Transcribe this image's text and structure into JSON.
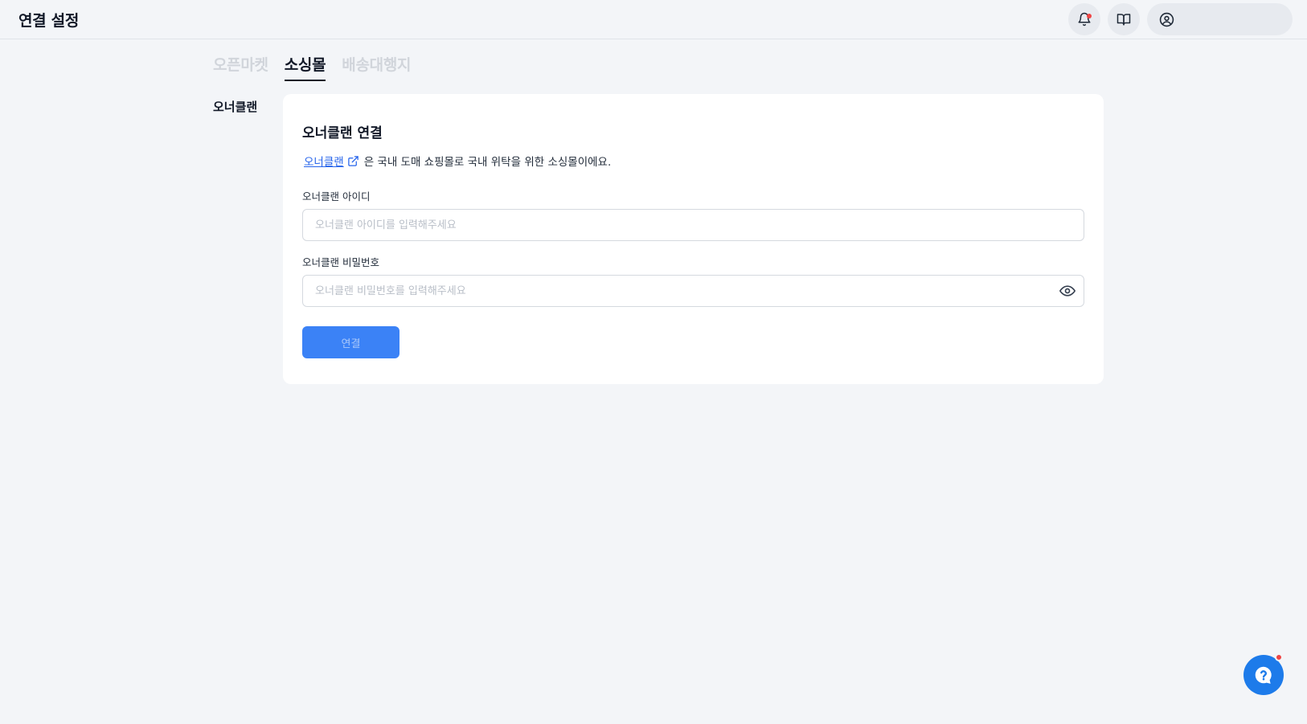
{
  "header": {
    "title": "연결 설정",
    "profile_name": ""
  },
  "tabs": [
    {
      "label": "오픈마켓",
      "active": false
    },
    {
      "label": "소싱몰",
      "active": true
    },
    {
      "label": "배송대행지",
      "active": false
    }
  ],
  "sidebar": {
    "selected_label": "오너클랜"
  },
  "card": {
    "title": "오너클랜 연결",
    "link_text": "오너클랜",
    "description": "은 국내 도매 쇼핑몰로 국내 위탁을 위한 소싱몰이에요.",
    "id_field": {
      "label": "오너클랜 아이디",
      "placeholder": "오너클랜 아이디를 입력해주세요",
      "value": ""
    },
    "password_field": {
      "label": "오너클랜 비밀번호",
      "placeholder": "오너클랜 비밀번호를 입력해주세요",
      "value": ""
    },
    "connect_button": "연결"
  },
  "colors": {
    "accent": "#3b82f6",
    "link": "#2563eb",
    "background": "#f3f5f8",
    "notification": "#ef4444",
    "help_fab": "#1d7bea"
  },
  "icons": {
    "notification": "bell-icon",
    "guide": "book-open-icon",
    "profile": "user-circle-icon",
    "external_link": "external-link-icon",
    "password_toggle": "eye-icon",
    "help": "help-question-icon"
  }
}
